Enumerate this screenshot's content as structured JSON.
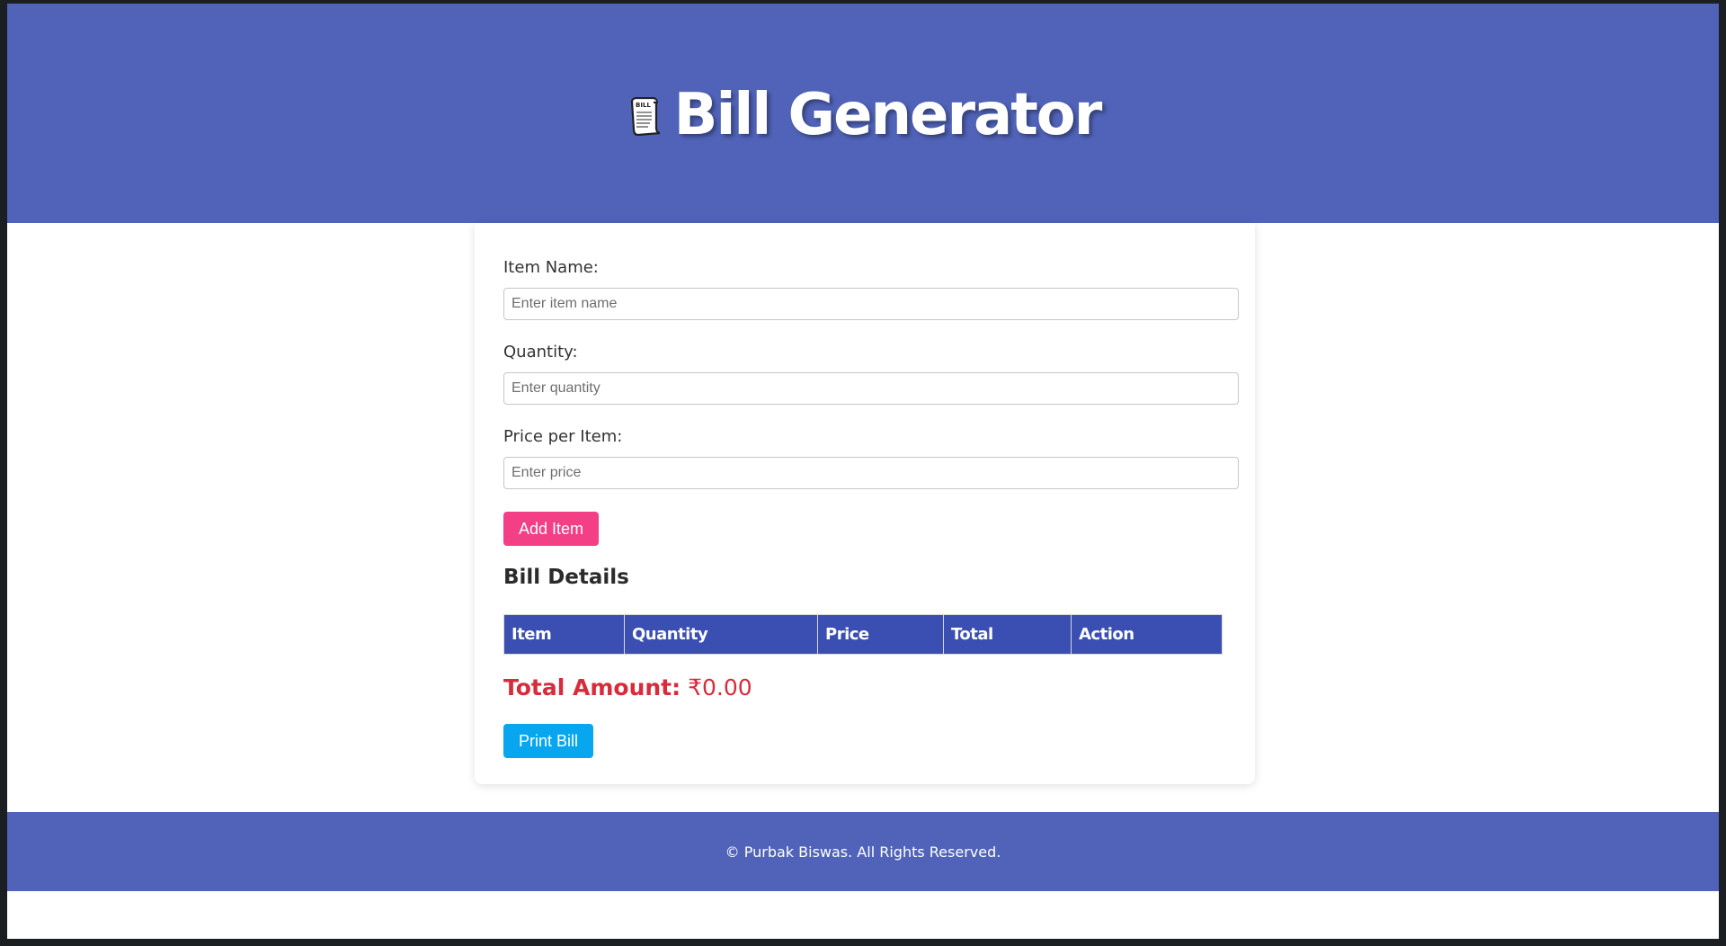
{
  "header": {
    "icon": "bill-scroll-icon",
    "icon_text": "BILL",
    "title": "Bill Generator"
  },
  "form": {
    "item_name": {
      "label": "Item Name:",
      "placeholder": "Enter item name",
      "value": ""
    },
    "quantity": {
      "label": "Quantity:",
      "placeholder": "Enter quantity",
      "value": ""
    },
    "price": {
      "label": "Price per Item:",
      "placeholder": "Enter price",
      "value": ""
    },
    "add_button": "Add Item"
  },
  "bill": {
    "heading": "Bill Details",
    "columns": [
      "Item",
      "Quantity",
      "Price",
      "Total",
      "Action"
    ],
    "rows": [],
    "total_label": "Total Amount:",
    "total_value": "₹0.00",
    "print_button": "Print Bill"
  },
  "footer": {
    "text": "© Purbak Biswas. All Rights Reserved."
  },
  "colors": {
    "header_bg": "#5063b8",
    "table_header_bg": "#3a4fb1",
    "add_button": "#f23f86",
    "print_button": "#08a6ee",
    "total_text": "#d62c3b"
  }
}
